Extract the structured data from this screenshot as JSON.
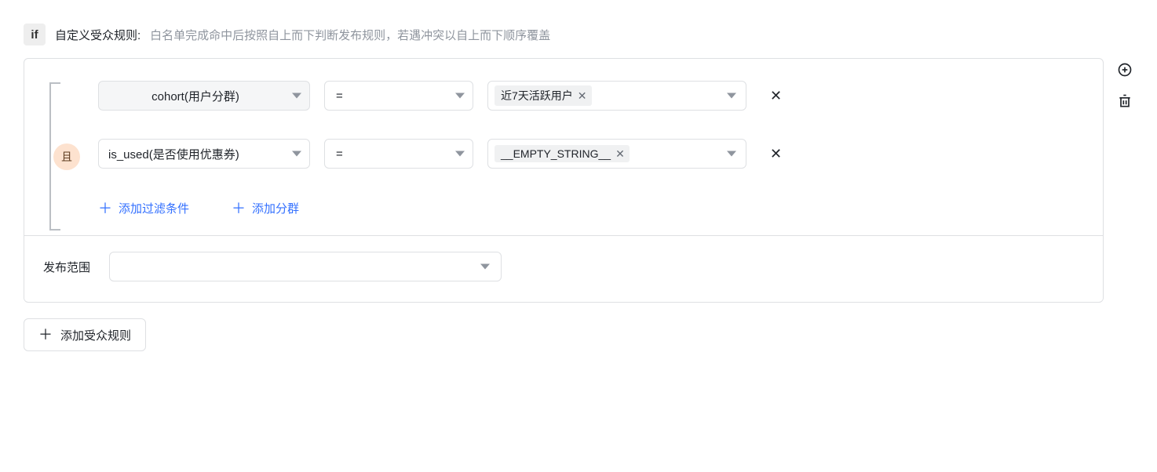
{
  "header": {
    "badge": "if",
    "label": "自定义受众规则:",
    "hint": "白名单完成命中后按照自上而下判断发布规则，若遇冲突以自上而下顺序覆盖"
  },
  "group": {
    "join_label": "且",
    "rows": [
      {
        "field": "cohort(用户分群)",
        "operator": "=",
        "value_tag": "近7天活跃用户"
      },
      {
        "field": "is_used(是否使用优惠券)",
        "operator": "=",
        "value_tag": "__EMPTY_STRING__"
      }
    ],
    "add_filter_label": "添加过滤条件",
    "add_group_label": "添加分群"
  },
  "release": {
    "label": "发布范围"
  },
  "footer": {
    "add_rule_label": "添加受众规则"
  }
}
